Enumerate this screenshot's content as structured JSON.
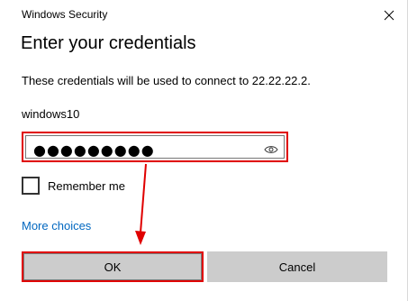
{
  "window": {
    "title": "Windows Security",
    "close_icon": "close-icon"
  },
  "dialog": {
    "heading": "Enter your credentials",
    "message": "These credentials will be used to connect to 22.22.22.2.",
    "username": "windows10",
    "password": {
      "masked_value": "●●●●●●●●●",
      "reveal_icon": "eye-icon"
    },
    "remember_me": {
      "label": "Remember me",
      "checked": false
    },
    "more_choices_label": "More choices",
    "ok_label": "OK",
    "cancel_label": "Cancel"
  },
  "annotation": {
    "highlight_color": "#e00000",
    "arrow_color": "#e00000"
  },
  "colors": {
    "link": "#0067c0",
    "button_bg": "#cccccc"
  }
}
